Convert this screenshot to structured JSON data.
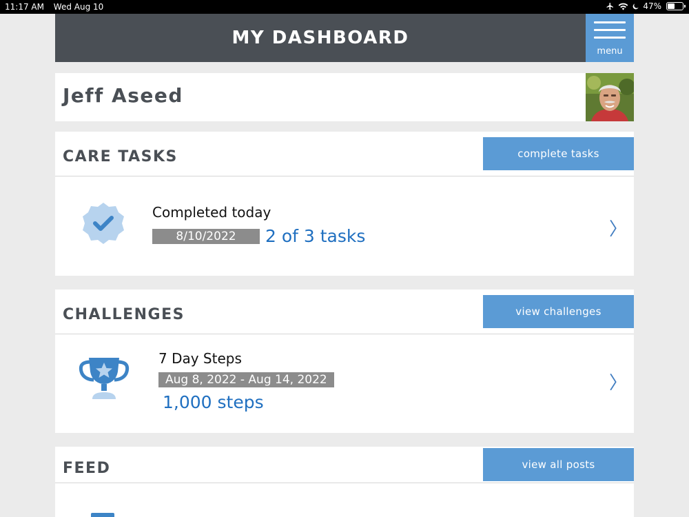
{
  "status_bar": {
    "time": "11:17 AM",
    "date": "Wed Aug 10",
    "battery": "47%",
    "battery_level": 0.47
  },
  "header": {
    "title": "MY DASHBOARD",
    "menu_label": "menu"
  },
  "profile": {
    "name": "Jeff Aseed"
  },
  "care_tasks": {
    "title": "CARE TASKS",
    "button_label": "complete tasks",
    "item_title": "Completed today",
    "date": "8/10/2022",
    "progress": "2 of 3 tasks"
  },
  "challenges": {
    "title": "CHALLENGES",
    "button_label": "view challenges",
    "item_title": "7 Day Steps",
    "date_range": "Aug 8, 2022 - Aug 14, 2022",
    "steps": "1,000 steps"
  },
  "feed": {
    "title": "FEED",
    "button_label": "view all posts"
  },
  "icons": {
    "task_badge": "verified-check-icon",
    "challenge": "trophy-icon",
    "chevron": "chevron-right-icon"
  },
  "colors": {
    "header_bg": "#4a4f55",
    "accent": "#5b9bd5",
    "link": "#1f6fc0",
    "badge_bg": "#8c8c8c"
  }
}
